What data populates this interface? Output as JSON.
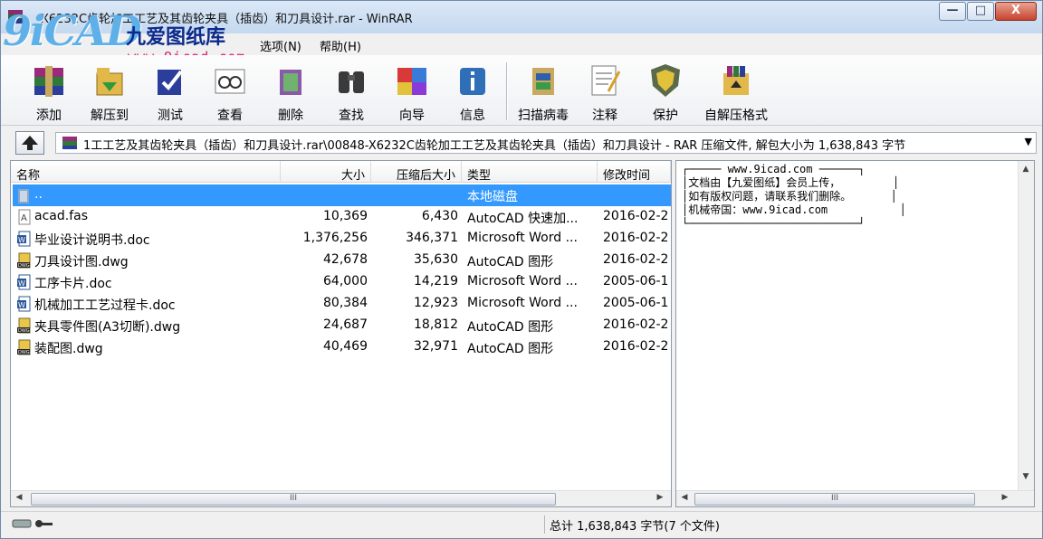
{
  "window": {
    "title": "X6232C齿轮加工工艺及其齿轮夹具（插齿）和刀具设计.rar - WinRAR",
    "buttons": {
      "minimize": "—",
      "maximize": "□",
      "close": "X"
    }
  },
  "watermark": {
    "logo": "9iCAD",
    "name": "九爱图纸库",
    "url": "www.9icad.com"
  },
  "menubar": {
    "items": [
      {
        "label": "选项(N)"
      },
      {
        "label": "帮助(H)"
      }
    ]
  },
  "toolbar": {
    "buttons": [
      {
        "label": "添加",
        "icon": "add-archive-icon"
      },
      {
        "label": "解压到",
        "icon": "extract-to-icon"
      },
      {
        "label": "测试",
        "icon": "test-icon"
      },
      {
        "label": "查看",
        "icon": "view-icon"
      },
      {
        "label": "删除",
        "icon": "delete-icon"
      },
      {
        "label": "查找",
        "icon": "find-icon"
      },
      {
        "label": "向导",
        "icon": "wizard-icon"
      },
      {
        "label": "信息",
        "icon": "info-icon"
      },
      {
        "label": "扫描病毒",
        "icon": "virus-scan-icon"
      },
      {
        "label": "注释",
        "icon": "comment-icon"
      },
      {
        "label": "保护",
        "icon": "protect-icon"
      },
      {
        "label": "自解压格式",
        "icon": "sfx-icon"
      }
    ]
  },
  "address": {
    "path": "1工工艺及其齿轮夹具（插齿）和刀具设计.rar\\00848-X6232C齿轮加工工艺及其齿轮夹具（插齿）和刀具设计 - RAR 压缩文件, 解包大小为 1,638,843 字节"
  },
  "file_list": {
    "columns": {
      "name": "名称",
      "size": "大小",
      "packed": "压缩后大小",
      "type": "类型",
      "modified": "修改时间"
    },
    "rows": [
      {
        "name": "..",
        "size": "",
        "packed": "",
        "type": "本地磁盘",
        "modified": "",
        "icon": "folder-up-icon",
        "selected": true
      },
      {
        "name": "acad.fas",
        "size": "10,369",
        "packed": "6,430",
        "type": "AutoCAD 快速加...",
        "modified": "2016-02-2",
        "icon": "fas-file-icon"
      },
      {
        "name": "毕业设计说明书.doc",
        "size": "1,376,256",
        "packed": "346,371",
        "type": "Microsoft Word ...",
        "modified": "2016-02-2",
        "icon": "word-doc-icon"
      },
      {
        "name": "刀具设计图.dwg",
        "size": "42,678",
        "packed": "35,630",
        "type": "AutoCAD 图形",
        "modified": "2016-02-2",
        "icon": "dwg-file-icon"
      },
      {
        "name": "工序卡片.doc",
        "size": "64,000",
        "packed": "14,219",
        "type": "Microsoft Word ...",
        "modified": "2005-06-1",
        "icon": "word-doc-icon"
      },
      {
        "name": "机械加工工艺过程卡.doc",
        "size": "80,384",
        "packed": "12,923",
        "type": "Microsoft Word ...",
        "modified": "2005-06-1",
        "icon": "word-doc-icon"
      },
      {
        "name": "夹具零件图(A3切断).dwg",
        "size": "24,687",
        "packed": "18,812",
        "type": "AutoCAD 图形",
        "modified": "2016-02-2",
        "icon": "dwg-file-icon"
      },
      {
        "name": "装配图.dwg",
        "size": "40,469",
        "packed": "32,971",
        "type": "AutoCAD 图形",
        "modified": "2016-02-2",
        "icon": "dwg-file-icon"
      }
    ]
  },
  "comment_panel": {
    "text": "┌───── www.9icad.com ──────┐\n│文档由【九爱图纸】会员上传，        │\n│如有版权问题，请联系我们删除。      │\n│机械帝国：www.9icad.com           │\n└──────────────────────────┘"
  },
  "status": {
    "text": "总计 1,638,843 字节(7 个文件)"
  },
  "scroll": {
    "grip": "III",
    "left": "◀",
    "right": "▶",
    "up": "▲",
    "down": "▼"
  }
}
